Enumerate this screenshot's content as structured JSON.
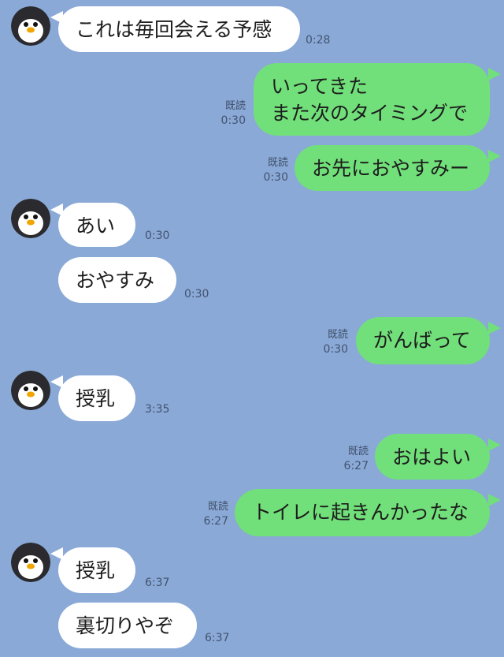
{
  "chat": {
    "messages": [
      {
        "side": "in",
        "avatar": "penguin-icon",
        "text": "これは毎回会える予感",
        "time": "0:28"
      },
      {
        "side": "out",
        "text": "いってきた\nまた次のタイミングで",
        "read": "既読",
        "time": "0:30"
      },
      {
        "side": "out",
        "text": "お先におやすみー",
        "read": "既読",
        "time": "0:30"
      },
      {
        "side": "in",
        "avatar": "penguin-icon",
        "text": "あい",
        "time": "0:30"
      },
      {
        "side": "in",
        "text": "おやすみ",
        "time": "0:30"
      },
      {
        "side": "out",
        "text": "がんばって",
        "read": "既読",
        "time": "0:30"
      },
      {
        "side": "in",
        "avatar": "penguin-icon",
        "text": "授乳",
        "time": "3:35"
      },
      {
        "side": "out",
        "text": "おはよい",
        "read": "既読",
        "time": "6:27"
      },
      {
        "side": "out",
        "text": "トイレに起きんかったな",
        "read": "既読",
        "time": "6:27"
      },
      {
        "side": "in",
        "avatar": "penguin-icon",
        "text": "授乳",
        "time": "6:37"
      },
      {
        "side": "in",
        "text": "裏切りやぞ",
        "time": "6:37"
      }
    ]
  },
  "colors": {
    "background": "#8aa9d7",
    "incoming_bubble": "#ffffff",
    "outgoing_bubble": "#71e07a",
    "meta_text": "#43536f"
  }
}
